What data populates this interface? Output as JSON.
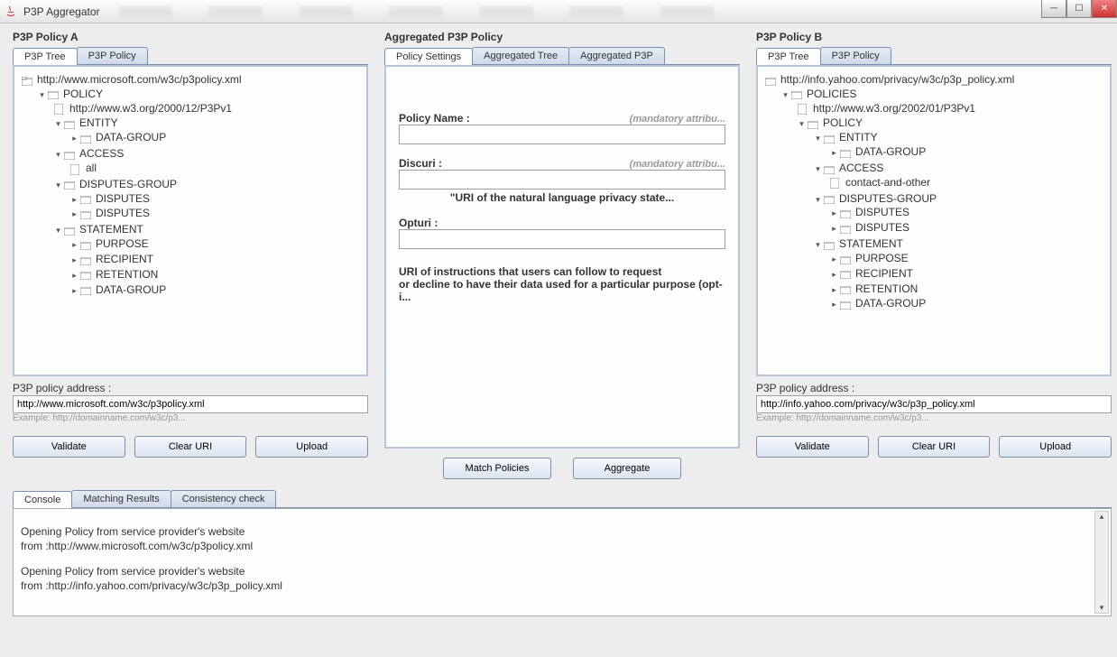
{
  "window": {
    "title": "P3P Aggregator"
  },
  "panelA": {
    "title": "P3P Policy A",
    "tabs": {
      "tree": "P3P Tree",
      "policy": "P3P Policy"
    },
    "tree": {
      "root": "http://www.microsoft.com/w3c/p3policy.xml",
      "policy": "POLICY",
      "xmlns": "http://www.w3.org/2000/12/P3Pv1",
      "entity": "ENTITY",
      "datagroup": "DATA-GROUP",
      "access": "ACCESS",
      "all": "all",
      "disputesgroup": "DISPUTES-GROUP",
      "disputes": "DISPUTES",
      "statement": "STATEMENT",
      "purpose": "PURPOSE",
      "recipient": "RECIPIENT",
      "retention": "RETENTION"
    },
    "address": {
      "label": "P3P policy address :",
      "value": "http://www.microsoft.com/w3c/p3policy.xml",
      "example": "Example: http://domainname.com/w3c/p3..."
    },
    "buttons": {
      "validate": "Validate",
      "clear": "Clear URI",
      "upload": "Upload"
    }
  },
  "panelAgg": {
    "title": "Aggregated P3P Policy",
    "tabs": {
      "settings": "Policy Settings",
      "tree": "Aggregated Tree",
      "p3p": "Aggregated P3P"
    },
    "form": {
      "policyName": {
        "label": "Policy Name :",
        "hint": "(mandatory attribu..."
      },
      "discuri": {
        "label": "Discuri :",
        "hint": "(mandatory attribu...",
        "desc": "\"URI of the natural language privacy state..."
      },
      "opturi": {
        "label": "Opturi :",
        "desc1": "URI of instructions that users can follow to request",
        "desc2": "or decline to have their data used for a particular purpose (opt-i..."
      }
    },
    "buttons": {
      "match": "Match Policies",
      "aggregate": "Aggregate"
    }
  },
  "panelB": {
    "title": "P3P Policy B",
    "tabs": {
      "tree": "P3P Tree",
      "policy": "P3P Policy"
    },
    "tree": {
      "root": "http://info.yahoo.com/privacy/w3c/p3p_policy.xml",
      "policies": "POLICIES",
      "xmlns": "http://www.w3.org/2002/01/P3Pv1",
      "policy": "POLICY",
      "entity": "ENTITY",
      "datagroup": "DATA-GROUP",
      "access": "ACCESS",
      "contact": "contact-and-other",
      "disputesgroup": "DISPUTES-GROUP",
      "disputes": "DISPUTES",
      "statement": "STATEMENT",
      "purpose": "PURPOSE",
      "recipient": "RECIPIENT",
      "retention": "RETENTION"
    },
    "address": {
      "label": "P3P policy address :",
      "value": "http://info.yahoo.com/privacy/w3c/p3p_policy.xml",
      "example": "Example: http://domainname.com/w3c/p3..."
    },
    "buttons": {
      "validate": "Validate",
      "clear": "Clear URI",
      "upload": "Upload"
    }
  },
  "console": {
    "tabs": {
      "console": "Console",
      "matching": "Matching Results",
      "consistency": "Consistency check"
    },
    "lines": {
      "l1": "Opening Policy from service provider's website",
      "l2": "from  :http://www.microsoft.com/w3c/p3policy.xml",
      "l3": "Opening Policy from service provider's website",
      "l4": "from  :http://info.yahoo.com/privacy/w3c/p3p_policy.xml"
    }
  }
}
